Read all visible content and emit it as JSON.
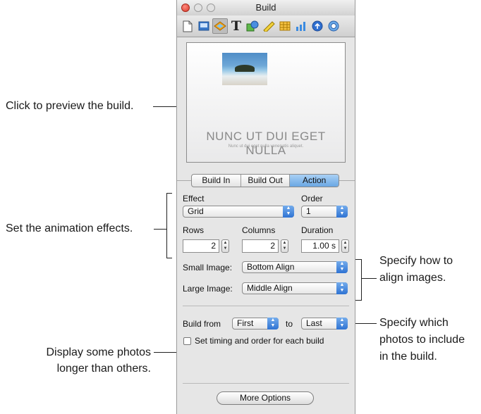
{
  "window": {
    "title": "Build"
  },
  "toolbar": {
    "icons": [
      "document-inspector-icon",
      "slide-inspector-icon",
      "build-inspector-icon",
      "text-inspector-icon",
      "graphic-inspector-icon",
      "metrics-inspector-icon",
      "table-inspector-icon",
      "chart-inspector-icon",
      "hyperlink-inspector-icon",
      "quicktime-inspector-icon"
    ]
  },
  "preview": {
    "slide_title": "NUNC UT DUI EGET NULLA",
    "slide_subtitle": "Nunc ut dui eget nulla venenatis aliquet."
  },
  "tabs": [
    "Build In",
    "Build Out",
    "Action"
  ],
  "active_tab": "Action",
  "effect": {
    "label": "Effect",
    "value": "Grid"
  },
  "order": {
    "label": "Order",
    "value": "1"
  },
  "rows": {
    "label": "Rows",
    "value": "2"
  },
  "columns": {
    "label": "Columns",
    "value": "2"
  },
  "duration": {
    "label": "Duration",
    "value": "1.00 s"
  },
  "small_image": {
    "label": "Small Image:",
    "value": "Bottom Align"
  },
  "large_image": {
    "label": "Large Image:",
    "value": "Middle Align"
  },
  "build_from": {
    "label": "Build from",
    "from": "First",
    "to_label": "to",
    "to": "Last"
  },
  "timing_checkbox": {
    "label": "Set timing and order for each build",
    "checked": false
  },
  "more_options": "More Options",
  "callouts": {
    "preview": "Click to preview the build.",
    "effects": "Set the animation effects.",
    "align_1": "Specify how to",
    "align_2": "align images.",
    "photos_1": "Specify which",
    "photos_2": "photos to include",
    "photos_3": "in the build.",
    "display_1": "Display some photos",
    "display_2": "longer than others."
  },
  "colors": {
    "accent": "#3b82dc",
    "active_tab": "#8cbdf0"
  }
}
